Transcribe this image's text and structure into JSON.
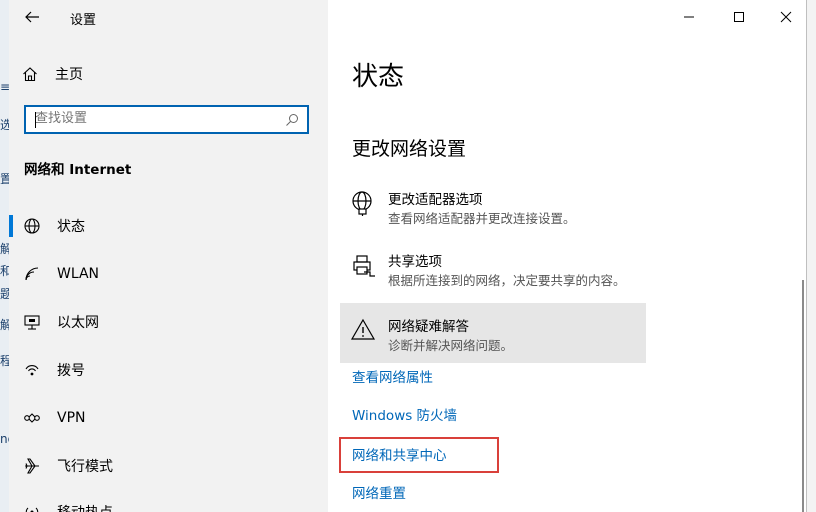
{
  "background_window": {
    "fragments": [
      "≡",
      "选",
      "置",
      "解",
      "和",
      "题",
      "解",
      "程",
      "nd"
    ]
  },
  "titlebar": {
    "title": "设置"
  },
  "sidebar": {
    "home_label": "主页",
    "search_placeholder": "查找设置",
    "section_heading": "网络和 Internet",
    "items": [
      {
        "label": "状态",
        "icon": "globe-icon",
        "selected": true
      },
      {
        "label": "WLAN",
        "icon": "wifi-icon"
      },
      {
        "label": "以太网",
        "icon": "ethernet-icon"
      },
      {
        "label": "拨号",
        "icon": "dialup-icon"
      },
      {
        "label": "VPN",
        "icon": "vpn-icon"
      },
      {
        "label": "飞行模式",
        "icon": "airplane-icon"
      },
      {
        "label": "移动热点",
        "icon": "hotspot-icon"
      }
    ]
  },
  "main": {
    "title": "状态",
    "subheading": "更改网络设置",
    "options": [
      {
        "title": "更改适配器选项",
        "desc": "查看网络适配器并更改连接设置。",
        "icon": "adapter-globe-icon"
      },
      {
        "title": "共享选项",
        "desc": "根据所连接到的网络，决定要共享的内容。",
        "icon": "printer-share-icon"
      },
      {
        "title": "网络疑难解答",
        "desc": "诊断并解决网络问题。",
        "icon": "warning-icon"
      }
    ],
    "links": [
      "查看网络属性",
      "Windows 防火墙",
      "网络和共享中心",
      "网络重置"
    ]
  },
  "colors": {
    "accent": "#0078d7",
    "link": "#0067b8",
    "highlight_box": "#d9403a",
    "sidebar_bg": "#f2f2f2"
  }
}
